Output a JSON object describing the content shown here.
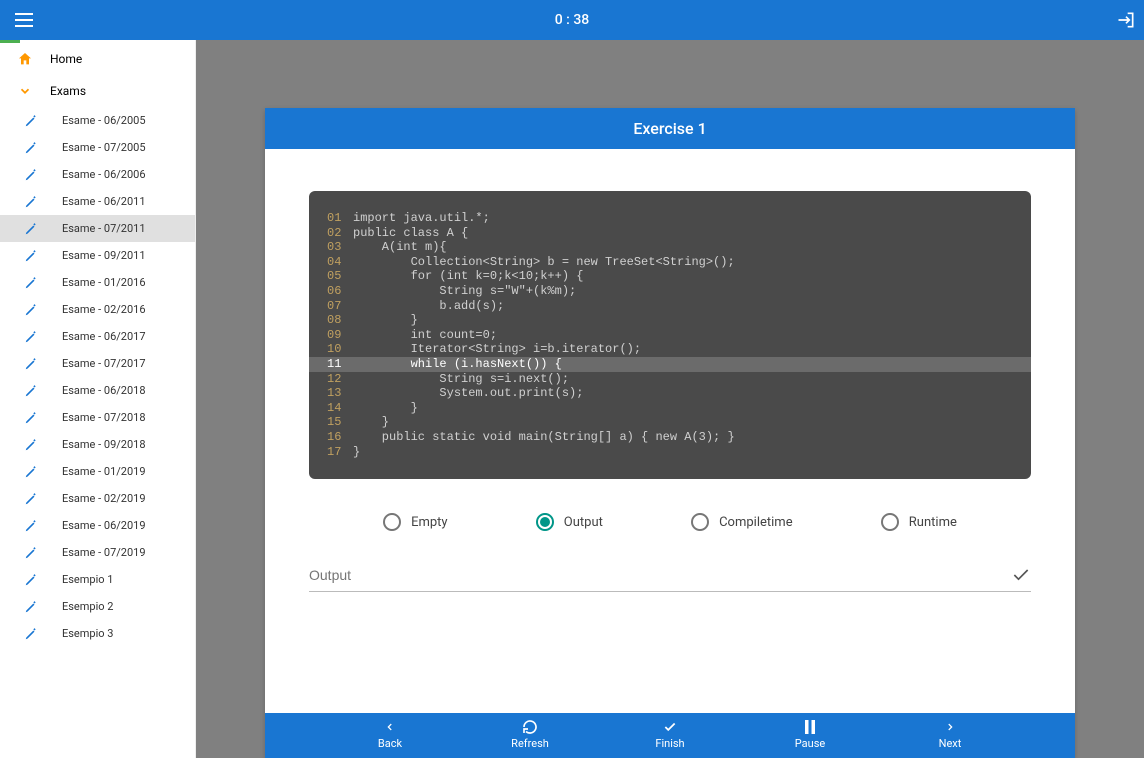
{
  "header": {
    "timer": "0 : 38"
  },
  "sidebar": {
    "home_label": "Home",
    "exams_label": "Exams",
    "items": [
      {
        "label": "Esame - 06/2005",
        "active": false
      },
      {
        "label": "Esame - 07/2005",
        "active": false
      },
      {
        "label": "Esame - 06/2006",
        "active": false
      },
      {
        "label": "Esame - 06/2011",
        "active": false
      },
      {
        "label": "Esame - 07/2011",
        "active": true
      },
      {
        "label": "Esame - 09/2011",
        "active": false
      },
      {
        "label": "Esame - 01/2016",
        "active": false
      },
      {
        "label": "Esame - 02/2016",
        "active": false
      },
      {
        "label": "Esame - 06/2017",
        "active": false
      },
      {
        "label": "Esame - 07/2017",
        "active": false
      },
      {
        "label": "Esame - 06/2018",
        "active": false
      },
      {
        "label": "Esame - 07/2018",
        "active": false
      },
      {
        "label": "Esame - 09/2018",
        "active": false
      },
      {
        "label": "Esame - 01/2019",
        "active": false
      },
      {
        "label": "Esame - 02/2019",
        "active": false
      },
      {
        "label": "Esame - 06/2019",
        "active": false
      },
      {
        "label": "Esame - 07/2019",
        "active": false
      },
      {
        "label": "Esempio 1",
        "active": false
      },
      {
        "label": "Esempio 2",
        "active": false
      },
      {
        "label": "Esempio 3",
        "active": false
      }
    ]
  },
  "exercise": {
    "title": "Exercise 1",
    "code": [
      {
        "n": "01",
        "t": "import java.util.*;",
        "hl": false
      },
      {
        "n": "02",
        "t": "public class A {",
        "hl": false
      },
      {
        "n": "03",
        "t": "    A(int m){",
        "hl": false
      },
      {
        "n": "04",
        "t": "        Collection<String> b = new TreeSet<String>();",
        "hl": false
      },
      {
        "n": "05",
        "t": "        for (int k=0;k<10;k++) {",
        "hl": false
      },
      {
        "n": "06",
        "t": "            String s=\"W\"+(k%m);",
        "hl": false
      },
      {
        "n": "07",
        "t": "            b.add(s);",
        "hl": false
      },
      {
        "n": "08",
        "t": "        }",
        "hl": false
      },
      {
        "n": "09",
        "t": "        int count=0;",
        "hl": false
      },
      {
        "n": "10",
        "t": "        Iterator<String> i=b.iterator();",
        "hl": false
      },
      {
        "n": "11",
        "t": "        while (i.hasNext()) {",
        "hl": true
      },
      {
        "n": "12",
        "t": "            String s=i.next();",
        "hl": false
      },
      {
        "n": "13",
        "t": "            System.out.print(s);",
        "hl": false
      },
      {
        "n": "14",
        "t": "        }",
        "hl": false
      },
      {
        "n": "15",
        "t": "    }",
        "hl": false
      },
      {
        "n": "16",
        "t": "    public static void main(String[] a) { new A(3); }",
        "hl": false
      },
      {
        "n": "17",
        "t": "}",
        "hl": false
      }
    ],
    "options": [
      {
        "label": "Empty",
        "selected": false
      },
      {
        "label": "Output",
        "selected": true
      },
      {
        "label": "Compiletime",
        "selected": false
      },
      {
        "label": "Runtime",
        "selected": false
      }
    ],
    "output_placeholder": "Output"
  },
  "bottombar": {
    "back": "Back",
    "refresh": "Refresh",
    "finish": "Finish",
    "pause": "Pause",
    "next": "Next"
  }
}
